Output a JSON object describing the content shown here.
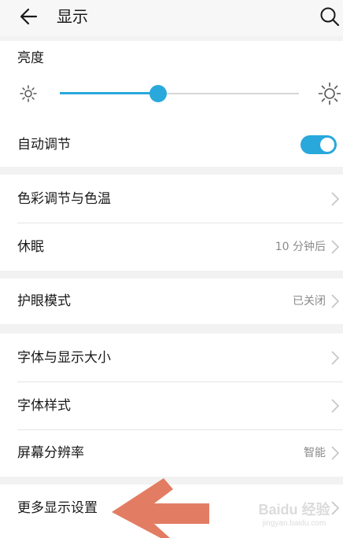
{
  "header": {
    "title": "显示",
    "back_icon": "arrow-left-icon",
    "search_icon": "search-icon"
  },
  "brightness": {
    "label": "亮度",
    "level": 0.41,
    "min_icon": "sun-small-icon",
    "max_icon": "sun-large-icon",
    "accent_color": "#29a8dc"
  },
  "auto_adjust": {
    "label": "自动调节",
    "enabled": true
  },
  "rows": [
    {
      "label": "色彩调节与色温",
      "value": ""
    },
    {
      "label": "休眠",
      "value": "10 分钟后"
    },
    {
      "label": "护眼模式",
      "value": "已关闭"
    },
    {
      "label": "字体与显示大小",
      "value": ""
    },
    {
      "label": "字体样式",
      "value": ""
    },
    {
      "label": "屏幕分辨率",
      "value": "智能"
    },
    {
      "label": "更多显示设置",
      "value": ""
    }
  ],
  "watermark": {
    "text": "Baidu 经验",
    "sub": "jingyan.baidu.com"
  }
}
